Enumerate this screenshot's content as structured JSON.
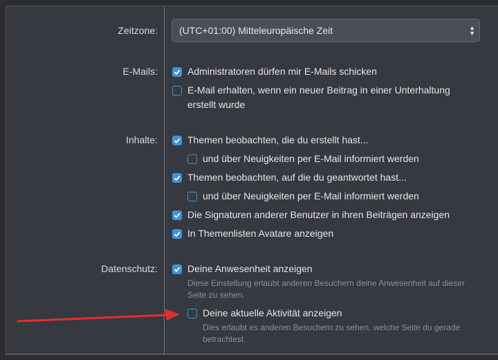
{
  "timezone": {
    "label": "Zeitzone:",
    "value": "(UTC+01:00) Mitteleuropäische Zeit"
  },
  "emails": {
    "label": "E-Mails:",
    "options": [
      {
        "text": "Administratoren dürfen mir E-Mails schicken",
        "checked": true
      },
      {
        "text": "E-Mail erhalten, wenn ein neuer Beitrag in einer Unterhaltung erstellt wurde",
        "checked": false
      }
    ]
  },
  "content": {
    "label": "Inhalte:",
    "options": [
      {
        "text": "Themen beobachten, die du erstellt hast...",
        "checked": true
      },
      {
        "text": "und über Neuigkeiten per E-Mail informiert werden",
        "checked": false
      },
      {
        "text": "Themen beobachten, auf die du geantwortet hast...",
        "checked": true
      },
      {
        "text": "und über Neuigkeiten per E-Mail informiert werden",
        "checked": false
      },
      {
        "text": "Die Signaturen anderer Benutzer in ihren Beiträgen anzeigen",
        "checked": true
      },
      {
        "text": "In Themenlisten Avatare anzeigen",
        "checked": true
      }
    ]
  },
  "privacy": {
    "label": "Datenschutz:",
    "options": [
      {
        "text": "Deine Anwesenheit anzeigen",
        "checked": true,
        "hint": "Diese Einstellung erlaubt anderen Besuchern deine Anwesenheit auf dieser Seite zu sehen."
      },
      {
        "text": "Deine aktuelle Aktivität anzeigen",
        "checked": false,
        "hint": "Dies erlaubt es anderen Besuchern zu sehen, welche Seite du gerade betrachtest."
      }
    ]
  },
  "colors": {
    "accent": "#3e93d8",
    "annotation_arrow": "#e0312b"
  }
}
